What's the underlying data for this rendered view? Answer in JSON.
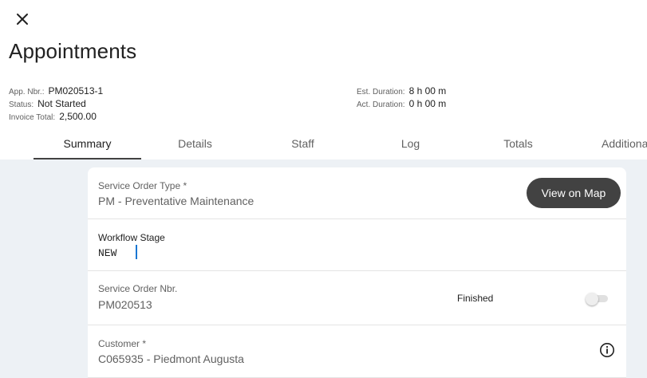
{
  "header": {
    "title": "Appointments"
  },
  "summary_meta": {
    "app_nbr_label": "App. Nbr.:",
    "app_nbr_value": "PM020513-1",
    "status_label": "Status:",
    "status_value": "Not Started",
    "invoice_total_label": "Invoice Total:",
    "invoice_total_value": "2,500.00",
    "est_duration_label": "Est. Duration:",
    "est_duration_value": "8 h 00 m",
    "act_duration_label": "Act. Duration:",
    "act_duration_value": "0 h 00 m"
  },
  "tabs": [
    {
      "label": "Summary",
      "active": true
    },
    {
      "label": "Details",
      "active": false
    },
    {
      "label": "Staff",
      "active": false
    },
    {
      "label": "Log",
      "active": false
    },
    {
      "label": "Totals",
      "active": false
    },
    {
      "label": "Additiona",
      "active": false
    }
  ],
  "form": {
    "service_order_type": {
      "label": "Service Order Type *",
      "value": "PM - Preventative Maintenance"
    },
    "view_on_map_label": "View on Map",
    "workflow_stage": {
      "label": "Workflow Stage",
      "value": "NEW"
    },
    "service_order_nbr": {
      "label": "Service Order Nbr.",
      "value": "PM020513"
    },
    "finished": {
      "label": "Finished",
      "checked": false
    },
    "customer": {
      "label": "Customer *",
      "value": "C065935 - Piedmont Augusta"
    }
  },
  "icons": {
    "close": "close-icon",
    "info": "info-icon"
  },
  "colors": {
    "content_background": "#edf1f5",
    "button_dark": "#424242",
    "cursor_accent": "#1976d2"
  }
}
